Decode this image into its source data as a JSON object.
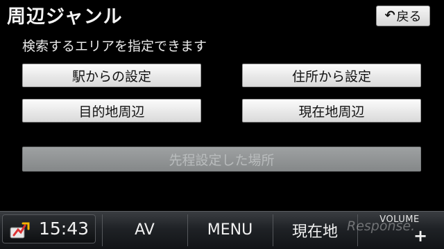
{
  "header": {
    "title": "周辺ジャンル",
    "back_label": "戻る"
  },
  "instruction": "検索するエリアを指定できます",
  "options": [
    {
      "label": "駅からの設定",
      "enabled": true
    },
    {
      "label": "住所から設定",
      "enabled": true
    },
    {
      "label": "目的地周辺",
      "enabled": true
    },
    {
      "label": "現在地周辺",
      "enabled": true
    },
    {
      "label": "先程設定した場所",
      "enabled": false
    }
  ],
  "bottom_bar": {
    "clock": "15:43",
    "av_label": "AV",
    "menu_label": "MENU",
    "current_location_label": "現在地",
    "volume_label": "VOLUME",
    "volume_up_symbol": "+"
  },
  "watermark": "Response.",
  "icons": [
    "back-arrow-icon",
    "gps-signal-icon"
  ],
  "colors": {
    "background": "#000000",
    "button_face": "#e8e8e8",
    "disabled_button": "#949798",
    "bar": "#1f2226"
  }
}
